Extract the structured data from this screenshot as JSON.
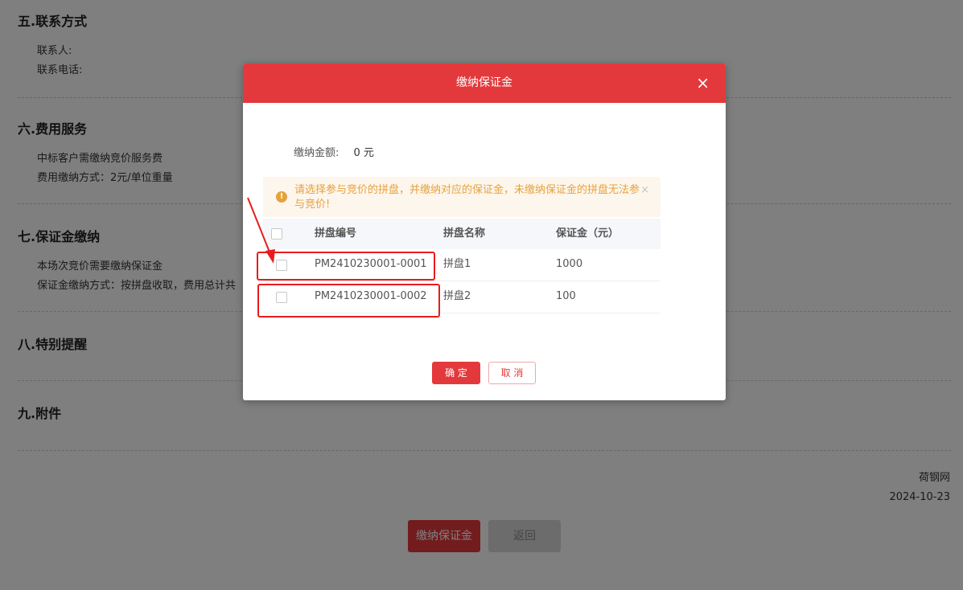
{
  "sections": {
    "s5": {
      "title": "五.联系方式",
      "lines": [
        "联系人:",
        "联系电话:"
      ]
    },
    "s6": {
      "title": "六.费用服务",
      "lines": [
        "中标客户需缴纳竞价服务费",
        "费用缴纳方式：2元/单位重量"
      ]
    },
    "s7": {
      "title": "七.保证金缴纳",
      "lines": [
        "本场次竞价需要缴纳保证金",
        "保证金缴纳方式：按拼盘收取，费用总计共"
      ]
    },
    "s8": {
      "title": "八.特别提醒"
    },
    "s9": {
      "title": "九.附件"
    }
  },
  "footer": {
    "company": "荷钢网",
    "date": "2024-10-23"
  },
  "bottom_buttons": {
    "pay": "缴纳保证金",
    "back": "返回"
  },
  "modal": {
    "title": "缴纳保证金",
    "close_icon": "×",
    "amount_label": "缴纳金额:",
    "amount_value": "0 元",
    "alert_icon": "!",
    "alert_text": "请选择参与竞价的拼盘，并缴纳对应的保证金，未缴纳保证金的拼盘无法参与竞价!",
    "alert_close": "×",
    "table": {
      "headers": [
        "拼盘编号",
        "拼盘名称",
        "保证金（元）"
      ],
      "rows": [
        {
          "code": "PM2410230001-0001",
          "name": "拼盘1",
          "amount": "1000"
        },
        {
          "code": "PM2410230001-0002",
          "name": "拼盘2",
          "amount": "100"
        }
      ]
    },
    "confirm": "确 定",
    "cancel": "取 消"
  },
  "colors": {
    "accent": "#e4393c",
    "warning": "#e6a23c",
    "annotation": "#e81c1c"
  }
}
